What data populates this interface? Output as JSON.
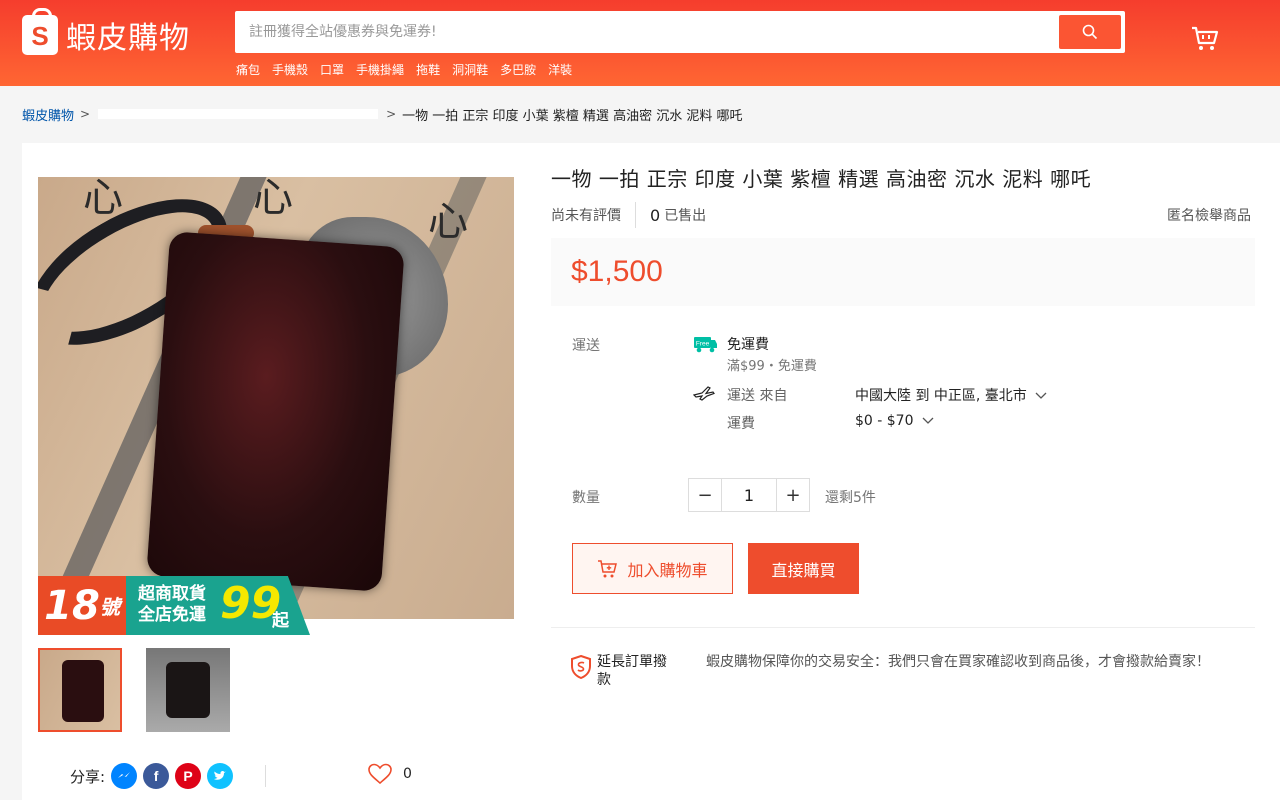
{
  "header": {
    "logo_letter": "S",
    "logo_text": "蝦皮購物",
    "search_placeholder": "註冊獲得全站優惠券與免運券!",
    "hot_words": [
      "痛包",
      "手機殼",
      "口罩",
      "手機掛繩",
      "拖鞋",
      "洞洞鞋",
      "多巴胺",
      "洋裝"
    ],
    "brand_color": "#ee4d2d"
  },
  "breadcrumb": {
    "home": "蝦皮購物",
    "current": "一物 一拍 正宗 印度 小葉 紫檀 精選 高油密 沉水 泥料 哪吒"
  },
  "product": {
    "title": "一物 一拍 正宗 印度 小葉 紫檀 精選 高油密 沉水 泥料 哪吒",
    "rating_text": "尚未有評價",
    "sold_count": "0",
    "sold_label": "已售出",
    "anon_report": "匿名檢舉商品",
    "price": "$1,500",
    "image_chars": [
      "心",
      "心",
      "心"
    ],
    "promo": {
      "number": "18",
      "number_suffix": "號",
      "line1": "超商取貨",
      "line2": "全店免運",
      "amount": "99",
      "suffix": "起"
    }
  },
  "shipping": {
    "label": "運送",
    "free_badge": "Free",
    "free_title": "免運費",
    "free_sub": "滿$99・免運費",
    "from_label": "運送 來自",
    "route": "中國大陸 到 中正區, 臺北市",
    "fee_label": "運費",
    "fee_value": "$0 - $70"
  },
  "quantity": {
    "label": "數量",
    "minus": "−",
    "value": "1",
    "plus": "+",
    "stock": "還剩5件"
  },
  "actions": {
    "add_to_cart": "加入購物車",
    "buy_now": "直接購買"
  },
  "guarantee": {
    "title": "延長訂單撥款",
    "desc": "蝦皮購物保障你的交易安全：我們只會在買家確認收到商品後，才會撥款給賣家！"
  },
  "social": {
    "share_label": "分享:",
    "likes": "0",
    "messenger_color": "#0084ff",
    "facebook_color": "#3b5999",
    "pinterest_color": "#de0217",
    "twitter_color": "#10c2ff"
  }
}
